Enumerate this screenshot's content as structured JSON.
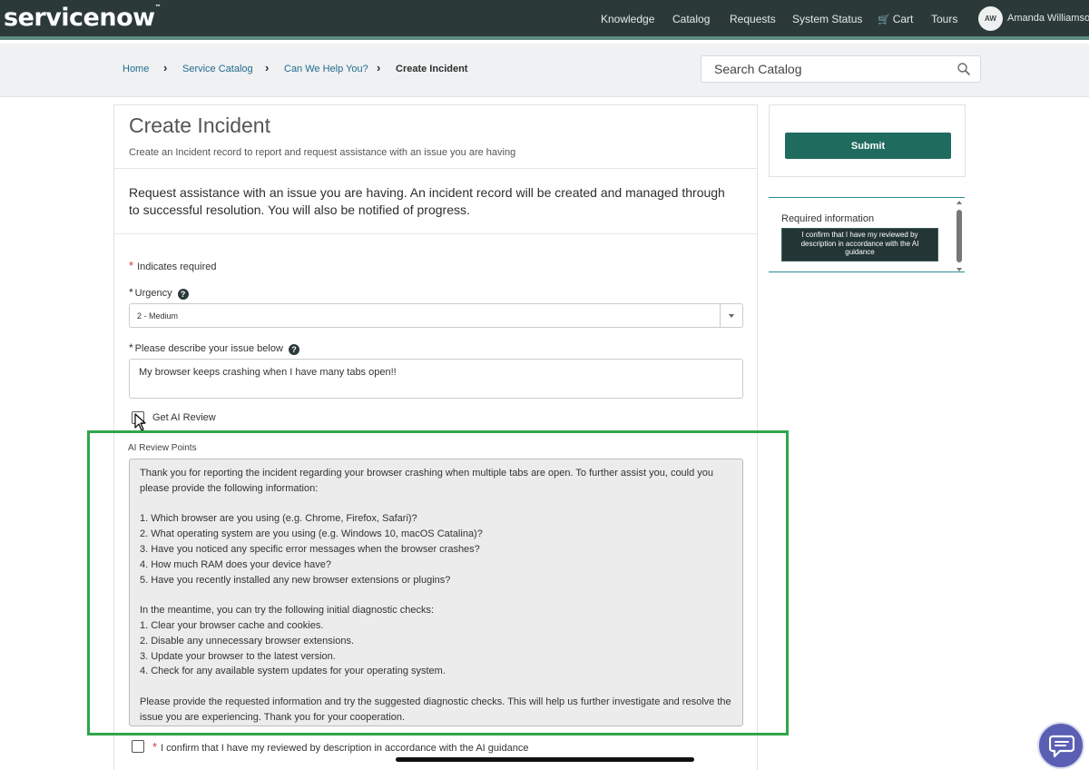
{
  "header": {
    "logo": "servicenow",
    "nav": [
      "Knowledge",
      "Catalog",
      "Requests",
      "System Status",
      "Cart",
      "Tours"
    ],
    "user_initials": "AW",
    "user_name": "Amanda Williamso"
  },
  "breadcrumb": {
    "items": [
      "Home",
      "Service Catalog",
      "Can We Help You?",
      "Create Incident"
    ]
  },
  "search": {
    "placeholder": "Search Catalog"
  },
  "form": {
    "title": "Create Incident",
    "subtitle": "Create an Incident record to report and request assistance with an issue you are having",
    "intro": "Request assistance with an issue you are having. An incident record will be created and managed through to successful resolution. You will also be notified of progress.",
    "required_note": "Indicates required",
    "urgency_label": "Urgency",
    "urgency_value": "2 - Medium",
    "describe_label": "Please describe your issue below",
    "describe_value": "My browser keeps crashing when I have many tabs open!!",
    "ai_review_checkbox_label": "Get AI Review",
    "ai_review_title": "AI Review Points",
    "ai_review_paragraphs": [
      "Thank you for reporting the incident regarding your browser crashing when multiple tabs are open. To further assist you, could you please provide the following information:",
      "1. Which browser are you using (e.g. Chrome, Firefox, Safari)?\n2. What operating system are you using (e.g. Windows 10, macOS Catalina)?\n3. Have you noticed any specific error messages when the browser crashes?\n4. How much RAM does your device have?\n5. Have you recently installed any new browser extensions or plugins?",
      "In the meantime, you can try the following initial diagnostic checks:\n1. Clear your browser cache and cookies.\n2. Disable any unnecessary browser extensions.\n3. Update your browser to the latest version.\n4. Check for any available system updates for your operating system.",
      "Please provide the requested information and try the suggested diagnostic checks. This will help us further investigate and resolve the issue you are experiencing. Thank you for your cooperation."
    ],
    "confirm_label": "I confirm that I have my reviewed by description in accordance with the AI guidance"
  },
  "sidebar": {
    "submit_label": "Submit",
    "required_title": "Required information",
    "required_item": "I confirm that I have my reviewed by description in accordance with the AI guidance"
  },
  "colors": {
    "header_bg": "#2b3a39",
    "submit_bg": "#1f6b5e",
    "highlight": "#2ea64a",
    "required_star": "#c83c36",
    "chat_bubble": "#5b5fb3"
  },
  "icons": {
    "search": "search-icon",
    "help": "help-icon",
    "cart": "cart-icon",
    "chat": "chat-icon"
  }
}
